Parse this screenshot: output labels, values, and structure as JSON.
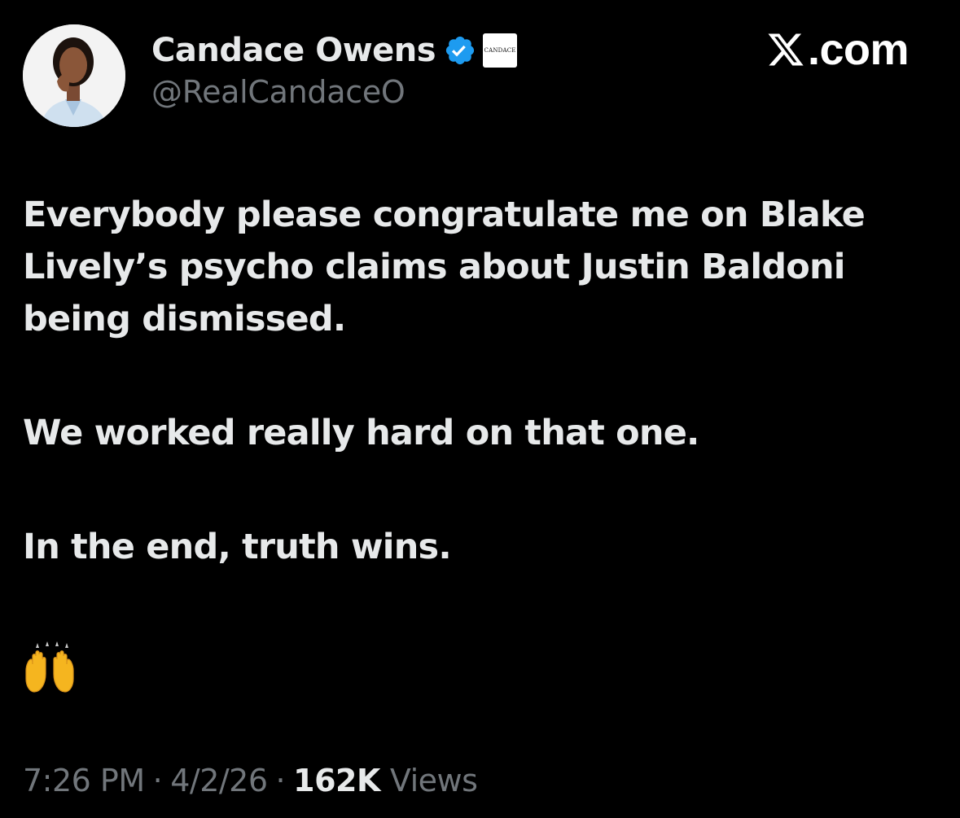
{
  "author": {
    "display_name": "Candace Owens",
    "handle": "@RealCandaceO",
    "verified": true,
    "affiliate_badge_text": "CANDACE"
  },
  "brand": {
    "label": ".com",
    "icon": "x-logo-icon"
  },
  "tweet": {
    "paragraphs": [
      "Everybody please congratulate me on Blake Lively’s psycho claims about Justin Baldoni being dismissed.",
      "We worked really hard on that one.",
      "In the end, truth wins."
    ],
    "emoji": "raising-hands-emoji"
  },
  "meta": {
    "time": "7:26 PM",
    "separator": "·",
    "date": "4/2/26",
    "views_count": "162K",
    "views_label": "Views"
  },
  "colors": {
    "background": "#000000",
    "text_primary": "#e7e9ea",
    "text_muted": "#71767b",
    "verified_blue": "#1d9bf0"
  }
}
